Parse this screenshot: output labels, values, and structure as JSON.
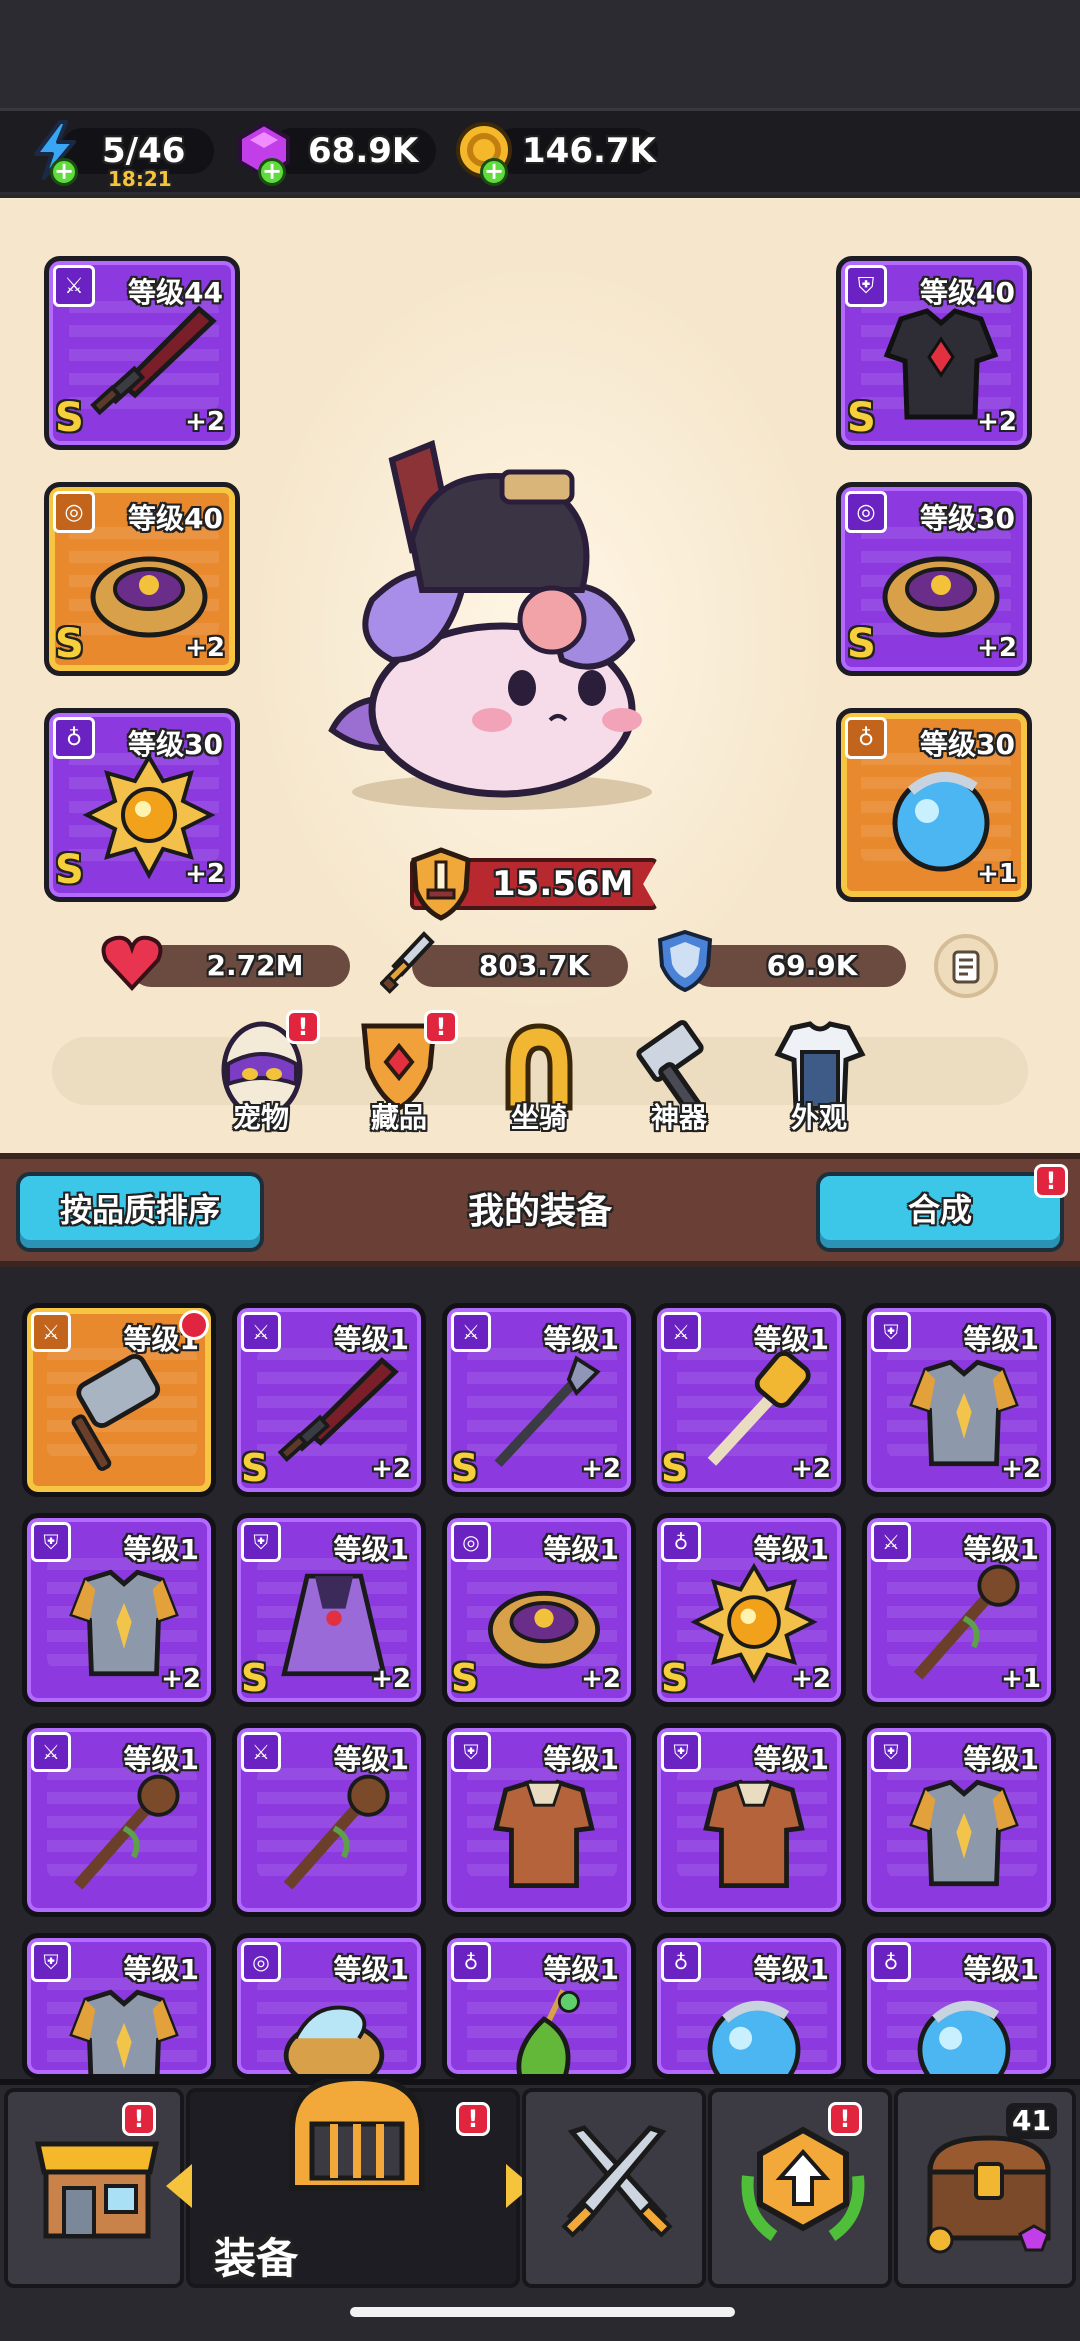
{
  "resources": {
    "energy": {
      "value": "5/46",
      "timer": "18:21",
      "icon": "lightning-icon"
    },
    "gems": {
      "value": "68.9K",
      "icon": "gem-icon"
    },
    "coins": {
      "value": "146.7K",
      "icon": "coin-icon"
    }
  },
  "hero": {
    "left_slots": [
      {
        "level": "等级44",
        "rank": "S",
        "plus": "+2",
        "rarity": "purple",
        "category_icon": "sword-icon",
        "item_icon": "red-greatsword-icon"
      },
      {
        "level": "等级40",
        "rank": "S",
        "plus": "+2",
        "rarity": "orange",
        "category_icon": "ring-icon",
        "item_icon": "golden-ring-icon"
      },
      {
        "level": "等级30",
        "rank": "S",
        "plus": "+2",
        "rarity": "purple",
        "category_icon": "amulet-icon",
        "item_icon": "sun-amulet-icon"
      }
    ],
    "right_slots": [
      {
        "level": "等级40",
        "rank": "S",
        "plus": "+2",
        "rarity": "purple",
        "category_icon": "armor-icon",
        "item_icon": "dark-armor-icon"
      },
      {
        "level": "等级30",
        "rank": "S",
        "plus": "+2",
        "rarity": "purple",
        "category_icon": "ring-icon",
        "item_icon": "golden-ring-icon"
      },
      {
        "level": "等级30",
        "rank": "",
        "plus": "+1",
        "rarity": "orange",
        "category_icon": "amulet-icon",
        "item_icon": "blue-orb-icon"
      }
    ],
    "power": "15.56M",
    "stats": {
      "hp": "2.72M",
      "attack": "803.7K",
      "defense": "69.9K"
    },
    "menu": [
      {
        "label": "宠物",
        "icon": "pet-egg-icon",
        "badge": "!"
      },
      {
        "label": "藏品",
        "icon": "collection-shield-icon",
        "badge": "!"
      },
      {
        "label": "坐骑",
        "icon": "horseshoe-icon",
        "badge": ""
      },
      {
        "label": "神器",
        "icon": "hammer-icon",
        "badge": ""
      },
      {
        "label": "外观",
        "icon": "outfit-icon",
        "badge": ""
      }
    ]
  },
  "section": {
    "sort_button": "按品质排序",
    "title": "我的装备",
    "merge_button": "合成",
    "merge_badge": "!"
  },
  "inventory": [
    {
      "level": "等级1",
      "rank": "",
      "plus": "",
      "rarity": "orange",
      "category_icon": "sword-icon",
      "item_icon": "stone-hammer-icon",
      "new": true
    },
    {
      "level": "等级1",
      "rank": "S",
      "plus": "+2",
      "rarity": "purple",
      "category_icon": "sword-icon",
      "item_icon": "red-greatsword-icon",
      "new": false
    },
    {
      "level": "等级1",
      "rank": "S",
      "plus": "+2",
      "rarity": "purple",
      "category_icon": "sword-icon",
      "item_icon": "spear-icon",
      "new": false
    },
    {
      "level": "等级1",
      "rank": "S",
      "plus": "+2",
      "rarity": "purple",
      "category_icon": "sword-icon",
      "item_icon": "golden-mace-icon",
      "new": false
    },
    {
      "level": "等级1",
      "rank": "",
      "plus": "+2",
      "rarity": "purple",
      "category_icon": "armor-icon",
      "item_icon": "steel-armor-icon",
      "new": false
    },
    {
      "level": "等级1",
      "rank": "",
      "plus": "+2",
      "rarity": "purple",
      "category_icon": "armor-icon",
      "item_icon": "steel-armor-icon",
      "new": false
    },
    {
      "level": "等级1",
      "rank": "S",
      "plus": "+2",
      "rarity": "purple",
      "category_icon": "armor-icon",
      "item_icon": "purple-cloak-icon",
      "new": false
    },
    {
      "level": "等级1",
      "rank": "S",
      "plus": "+2",
      "rarity": "purple",
      "category_icon": "ring-icon",
      "item_icon": "golden-ring-icon",
      "new": false
    },
    {
      "level": "等级1",
      "rank": "S",
      "plus": "+2",
      "rarity": "purple",
      "category_icon": "amulet-icon",
      "item_icon": "sun-amulet-icon",
      "new": false
    },
    {
      "level": "等级1",
      "rank": "",
      "plus": "+1",
      "rarity": "purple",
      "category_icon": "sword-icon",
      "item_icon": "wooden-staff-icon",
      "new": false
    },
    {
      "level": "等级1",
      "rank": "",
      "plus": "",
      "rarity": "purple",
      "category_icon": "sword-icon",
      "item_icon": "wooden-staff-icon",
      "new": false
    },
    {
      "level": "等级1",
      "rank": "",
      "plus": "",
      "rarity": "purple",
      "category_icon": "sword-icon",
      "item_icon": "wooden-staff-icon",
      "new": false
    },
    {
      "level": "等级1",
      "rank": "",
      "plus": "",
      "rarity": "purple",
      "category_icon": "armor-icon",
      "item_icon": "leather-armor-icon",
      "new": false
    },
    {
      "level": "等级1",
      "rank": "",
      "plus": "",
      "rarity": "purple",
      "category_icon": "armor-icon",
      "item_icon": "leather-armor-icon",
      "new": false
    },
    {
      "level": "等级1",
      "rank": "",
      "plus": "",
      "rarity": "purple",
      "category_icon": "armor-icon",
      "item_icon": "steel-armor-icon",
      "new": false
    },
    {
      "level": "等级1",
      "rank": "",
      "plus": "",
      "rarity": "purple",
      "category_icon": "armor-icon",
      "item_icon": "steel-armor-icon",
      "new": false
    },
    {
      "level": "等级1",
      "rank": "",
      "plus": "",
      "rarity": "purple",
      "category_icon": "ring-icon",
      "item_icon": "swirl-ring-icon",
      "new": false
    },
    {
      "level": "等级1",
      "rank": "",
      "plus": "",
      "rarity": "purple",
      "category_icon": "amulet-icon",
      "item_icon": "green-pendant-icon",
      "new": false
    },
    {
      "level": "等级1",
      "rank": "",
      "plus": "",
      "rarity": "purple",
      "category_icon": "amulet-icon",
      "item_icon": "blue-orb-icon",
      "new": false
    },
    {
      "level": "等级1",
      "rank": "",
      "plus": "",
      "rarity": "purple",
      "category_icon": "amulet-icon",
      "item_icon": "blue-orb-icon",
      "new": false
    }
  ],
  "nav": {
    "shop": {
      "icon": "shop-icon",
      "badge": "!"
    },
    "equipment": {
      "label": "装备",
      "icon": "helmet-icon",
      "badge": "!"
    },
    "battle": {
      "icon": "crossed-swords-icon"
    },
    "upgrade": {
      "icon": "upgrade-arrow-icon",
      "badge": "!"
    },
    "chest": {
      "icon": "treasure-chest-icon",
      "count": "41"
    }
  },
  "colors": {
    "purple": "#8c3ae0",
    "orange": "#e8892e",
    "accent_blue": "#3cc6e8",
    "badge_red": "#e2253e",
    "gold": "#f7cf3a"
  }
}
